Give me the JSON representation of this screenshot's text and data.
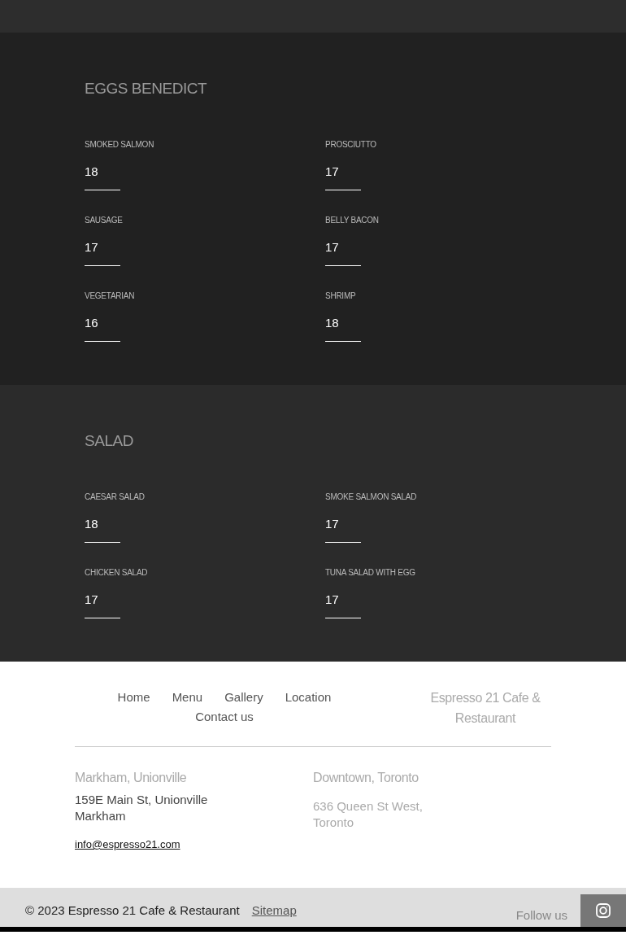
{
  "menu_sections": [
    {
      "title": "EGGS BENEDICT",
      "items": [
        {
          "name": "SMOKED SALMON",
          "price": "18"
        },
        {
          "name": "PROSCIUTTO",
          "price": "17"
        },
        {
          "name": "SAUSAGE",
          "price": "17"
        },
        {
          "name": "BELLY BACON",
          "price": "17"
        },
        {
          "name": "VEGETARIAN",
          "price": "16"
        },
        {
          "name": "SHRIMP",
          "price": "18"
        }
      ]
    },
    {
      "title": "SALAD",
      "items": [
        {
          "name": "CAESAR SALAD",
          "price": "18"
        },
        {
          "name": "SMOKE SALMON SALAD",
          "price": "17"
        },
        {
          "name": "CHICKEN SALAD",
          "price": "17"
        },
        {
          "name": "TUNA SALAD WITH EGG",
          "price": "17"
        }
      ]
    }
  ],
  "footer": {
    "nav": [
      {
        "label": "Home"
      },
      {
        "label": "Menu"
      },
      {
        "label": "Gallery"
      },
      {
        "label": "Location"
      },
      {
        "label": "Contact us"
      }
    ],
    "brand": "Espresso 21 Cafe & Restaurant",
    "locations": [
      {
        "title": "Markham, Unionville",
        "address": "159E Main St, Unionville Markham",
        "dimmed": false,
        "email": "info@espresso21.com"
      },
      {
        "title": "Downtown, Toronto",
        "address": "636 Queen St West, Toronto",
        "dimmed": true
      }
    ]
  },
  "bottom_bar": {
    "copyright": "© 2023 Espresso 21 Cafe & Restaurant",
    "sitemap": "Sitemap",
    "follow": "Follow us"
  }
}
